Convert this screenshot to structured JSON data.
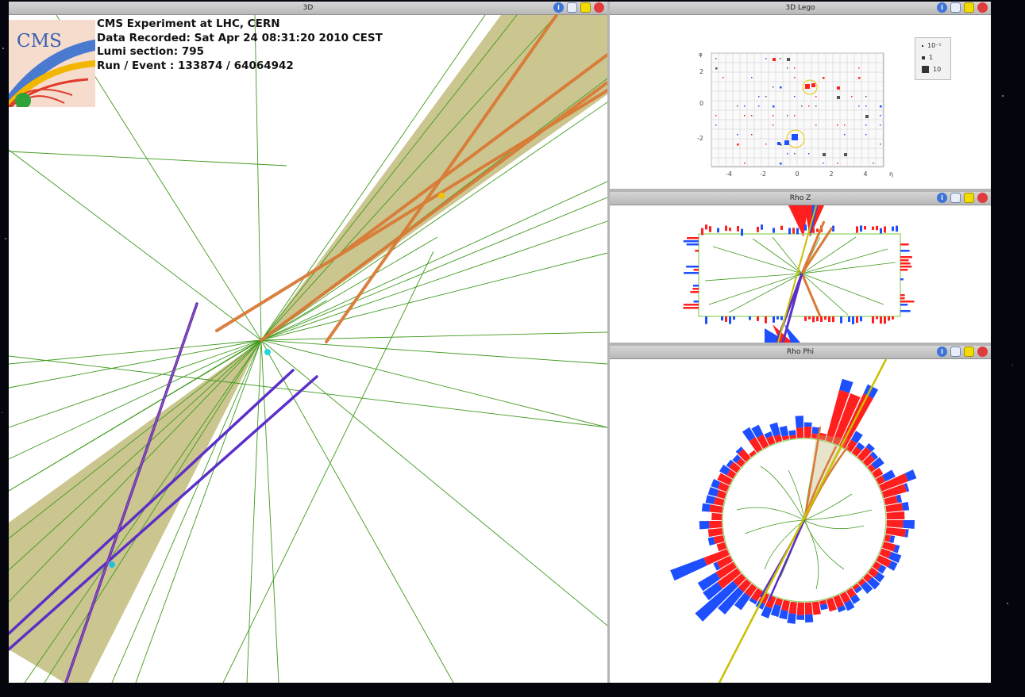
{
  "panels": {
    "main": {
      "title": "3D"
    },
    "lego": {
      "title": "3D Lego"
    },
    "rhoz": {
      "title": "Rho Z"
    },
    "rhophi": {
      "title": "Rho Phi"
    }
  },
  "event_info": {
    "logo_text": "CMS",
    "experiment": "CMS Experiment at LHC, CERN",
    "recorded": "Data Recorded: Sat Apr 24 08:31:20 2010 CEST",
    "lumi": "Lumi section: 795",
    "run_event": "Run / Event : 133874 / 64064942"
  },
  "lego_axes": {
    "x_ticks": [
      "-4",
      "-2",
      "0",
      "2",
      "4"
    ],
    "x_label": "η",
    "y_ticks": [
      "2",
      "0",
      "-2"
    ],
    "y_top_label": "φ"
  },
  "lego_legend": {
    "items": [
      "10⁻¹",
      "1",
      "10"
    ]
  },
  "icons": {
    "info": "info-icon",
    "save": "save-image-icon",
    "maximize": "maximize-icon",
    "close": "close-icon"
  },
  "colors": {
    "track": "#3f9a1d",
    "ecal": "#ff1f1f",
    "hcal": "#1d4fff",
    "muon": "#5b2fc8",
    "jet_cone": "#b9b36a",
    "electron": "#d97a36"
  }
}
